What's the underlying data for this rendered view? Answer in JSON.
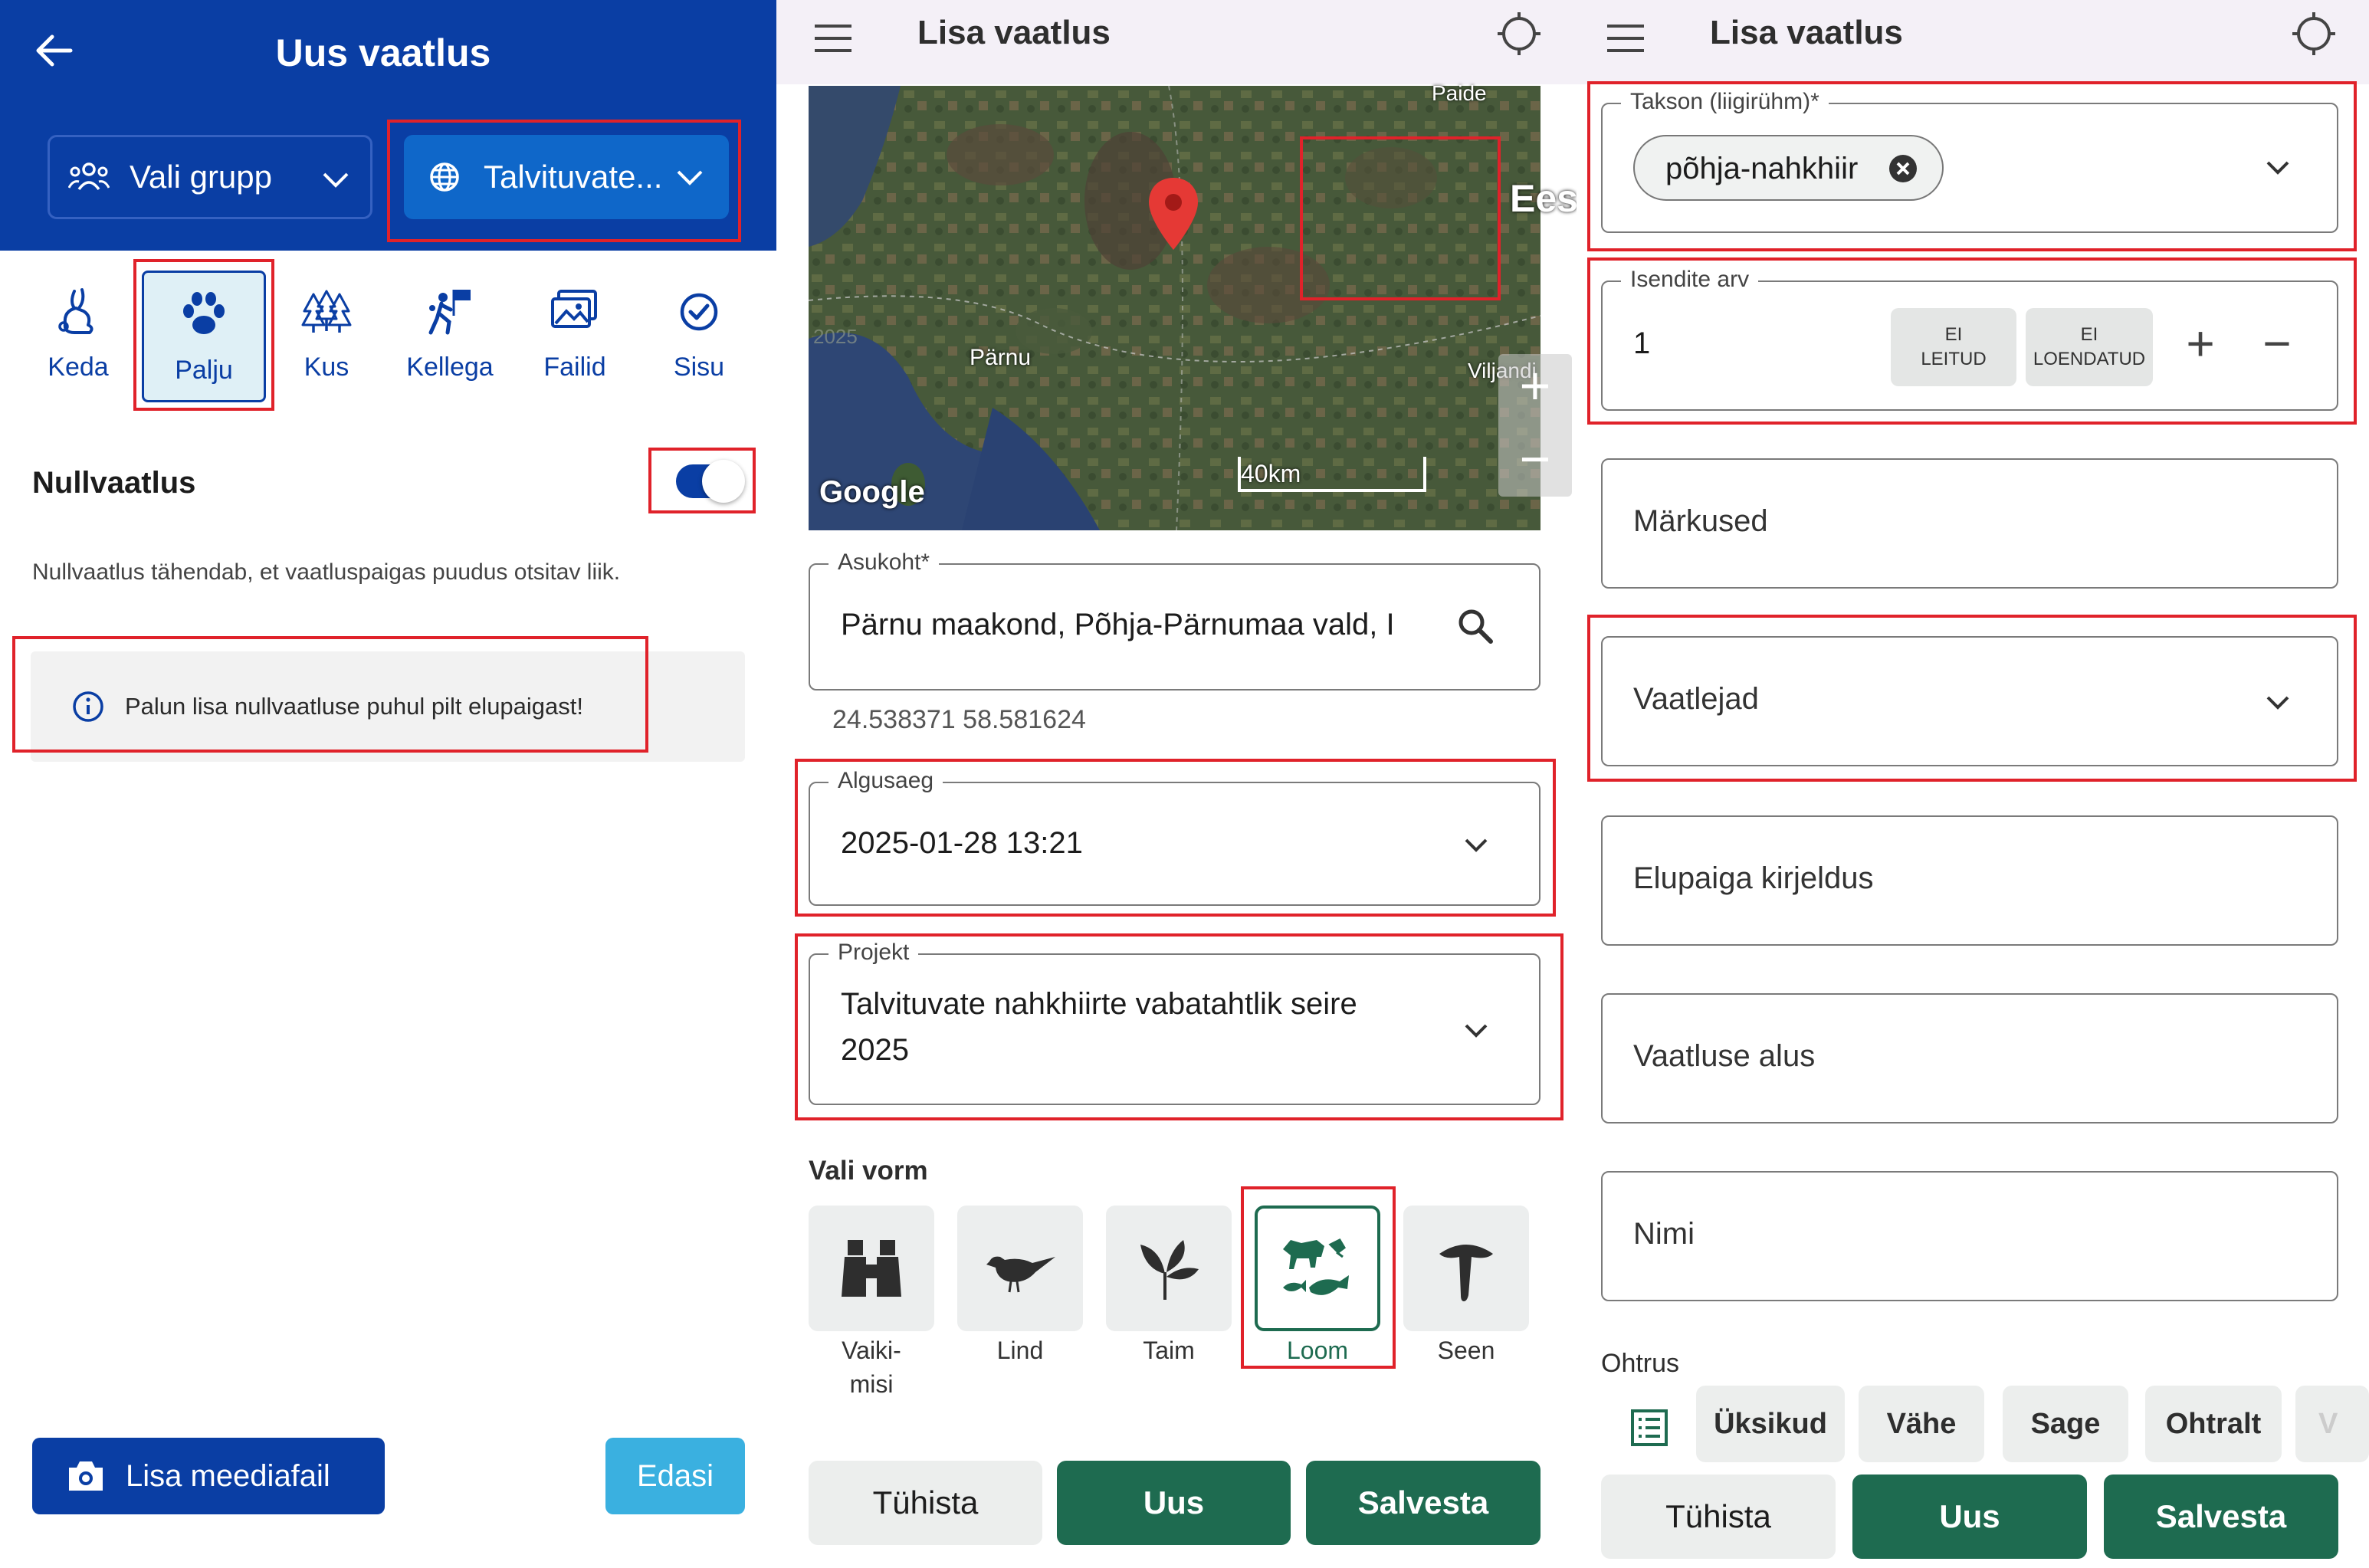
{
  "panel1": {
    "title": "Uus vaatlus",
    "group_select": "Vali grupp",
    "project_select": "Talvituvate...",
    "tabs": [
      {
        "label": "Keda",
        "icon": "rabbit-icon"
      },
      {
        "label": "Palju",
        "icon": "paw-icon"
      },
      {
        "label": "Kus",
        "icon": "trees-icon"
      },
      {
        "label": "Kellega",
        "icon": "hikers-icon"
      },
      {
        "label": "Failid",
        "icon": "images-icon"
      },
      {
        "label": "Sisu",
        "icon": "check-circle-icon"
      }
    ],
    "null_obs_label": "Nullvaatlus",
    "null_obs_on": true,
    "null_obs_description": "Nullvaatlus tähendab, et vaatluspaigas puudus otsitav liik.",
    "info_text": "Palun lisa nullvaatluse puhul pilt elupaigast!",
    "add_media_label": "Lisa meediafail",
    "next_label": "Edasi",
    "colors": {
      "primary": "#0a3ea4",
      "accent": "#3ab0e0"
    }
  },
  "panel2": {
    "title": "Lisa vaatlus",
    "map": {
      "labels": {
        "paide": "Paide",
        "ees": "Ees",
        "parnu": "Pärnu",
        "viljandi": "Viljandi",
        "google": "Google",
        "scale": "40km",
        "year": "2025"
      }
    },
    "location_label": "Asukoht*",
    "location_value": "Pärnu maakond, Põhja-Pärnumaa vald, I",
    "coords": "24.538371 58.581624",
    "start_label": "Algusaeg",
    "start_value": "2025-01-28 13:21",
    "project_label": "Projekt",
    "project_value_line1": "Talvituvate nahkhiirte vabatahtlik seire",
    "project_value_line2": "2025",
    "form_label": "Vali vorm",
    "forms": [
      {
        "label_line1": "Vaiki-",
        "label_line2": "misi",
        "icon": "binoculars-icon"
      },
      {
        "label_line1": "Lind",
        "label_line2": "",
        "icon": "bird-icon"
      },
      {
        "label_line1": "Taim",
        "label_line2": "",
        "icon": "leaf-icon"
      },
      {
        "label_line1": "Loom",
        "label_line2": "",
        "icon": "animals-icon",
        "selected": true
      },
      {
        "label_line1": "Seen",
        "label_line2": "",
        "icon": "mushroom-icon"
      }
    ],
    "cancel": "Tühista",
    "new": "Uus",
    "save": "Salvesta",
    "colors": {
      "green": "#1e6b50",
      "red_box": "#e0222a",
      "marker": "#e53935"
    }
  },
  "panel3": {
    "title": "Lisa vaatlus",
    "taxon_label": "Takson (liigirühm)*",
    "taxon_chip": "põhja-nahkhiir",
    "count_label": "Isendite arv",
    "count_value": "1",
    "not_found_line1": "EI",
    "not_found_line2": "LEITUD",
    "not_counted_line1": "EI",
    "not_counted_line2": "LOENDATUD",
    "plus": "+",
    "minus": "−",
    "notes": "Märkused",
    "observers": "Vaatlejad",
    "habitat": "Elupaiga kirjeldus",
    "basis": "Vaatluse alus",
    "name": "Nimi",
    "abundance_label": "Ohtrus",
    "abundance_options": [
      "Üksikud",
      "Vähe",
      "Sage",
      "Ohtralt",
      "V"
    ],
    "cancel": "Tühista",
    "new": "Uus",
    "save": "Salvesta"
  }
}
